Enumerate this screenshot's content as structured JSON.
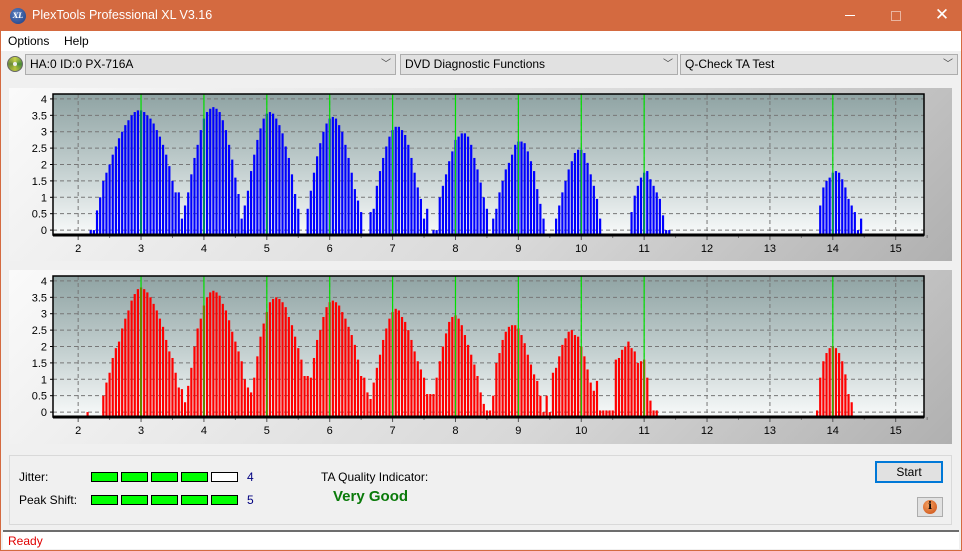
{
  "window": {
    "title": "PlexTools Professional XL V3.16",
    "app_icon_label": "XL",
    "controls": {
      "minimize": "minimize",
      "maximize": "maximize",
      "close": "✕"
    }
  },
  "menu": {
    "items": [
      "Options",
      "Help"
    ]
  },
  "toolbar": {
    "drive": "HA:0 ID:0  PX-716A",
    "function": "DVD Diagnostic Functions",
    "test": "Q-Check TA Test"
  },
  "colors": {
    "top_bars": "#0000ff",
    "bottom_bars": "#ff0000",
    "marker_lines": "#00e000",
    "titlebar": "#d46a40",
    "quality": "#0a7a0a"
  },
  "results": {
    "jitter_label": "Jitter:",
    "jitter_value": "4",
    "jitter_level": 4,
    "peak_shift_label": "Peak Shift:",
    "peak_shift_value": "5",
    "peak_shift_level": 5,
    "meter_max": 5,
    "ta_label": "TA Quality Indicator:",
    "ta_value": "Very Good"
  },
  "buttons": {
    "start": "Start",
    "info": "i"
  },
  "status": {
    "text": "Ready"
  },
  "chart_data": [
    {
      "type": "bar",
      "name": "top-ta-chart",
      "color": "#0000ff",
      "xlim": [
        1.6,
        15.45
      ],
      "ylim": [
        -0.15,
        4.15
      ],
      "xticks": [
        "2",
        "3",
        "4",
        "5",
        "6",
        "7",
        "8",
        "9",
        "10",
        "11",
        "12",
        "13",
        "14",
        "15"
      ],
      "yticks": [
        "0",
        "0.5",
        "1",
        "1.5",
        "2",
        "2.5",
        "3",
        "3.5",
        "4"
      ],
      "markers": [
        3,
        4,
        5,
        6,
        7,
        8,
        9,
        10,
        11,
        14
      ],
      "grid": true,
      "step": 0.05,
      "segments": [
        {
          "start": 2.2,
          "values": [
            0,
            0,
            0.6,
            1,
            1.5,
            1.75,
            2,
            2.3,
            2.55,
            2.8,
            3,
            3.2,
            3.35,
            3.5,
            3.6,
            3.65,
            3.65,
            3.6,
            3.5,
            3.4,
            3.25,
            3.05,
            2.85,
            2.6,
            2.3,
            1.95,
            1.5,
            1.15,
            1.15,
            0.35,
            0.75,
            1.15,
            1.7,
            2.2,
            2.6,
            3.05,
            3.4,
            3.6,
            3.7,
            3.75,
            3.7,
            3.6,
            3.35,
            3.05,
            2.6,
            2.15,
            1.6,
            1.1,
            0.35,
            0,
            0
          ]
        },
        {
          "start": 4.65,
          "values": [
            0.75,
            1.2,
            1.8,
            2.3,
            2.75,
            3.1,
            3.4,
            3.55,
            3.6,
            3.55,
            3.4,
            3.2,
            2.95,
            2.55,
            2.2,
            1.7,
            1.1,
            0.65
          ]
        },
        {
          "start": 5.65,
          "values": [
            0.65,
            1.2,
            1.75,
            2.25,
            2.65,
            3.0,
            3.25,
            3.4,
            3.45,
            3.4,
            3.2,
            3.0,
            2.6,
            2.2,
            1.75,
            1.25,
            0.9,
            0.55
          ]
        },
        {
          "start": 6.65,
          "values": [
            0.55,
            0.65,
            1.35,
            1.8,
            2.2,
            2.55,
            2.85,
            3.05,
            3.15,
            3.15,
            3.05,
            2.9,
            2.6,
            2.2,
            1.75,
            1.3,
            0.95,
            0.35,
            0.65
          ]
        },
        {
          "start": 7.65,
          "values": [
            0,
            0,
            1.0,
            1.35,
            1.7,
            2.1,
            2.4,
            2.75,
            2.85,
            2.95,
            2.95,
            2.85,
            2.6,
            2.2,
            1.85,
            1.45,
            1.0,
            0.65
          ]
        },
        {
          "start": 8.6,
          "values": [
            0.35,
            0.65,
            1.15,
            1.5,
            1.85,
            2.05,
            2.3,
            2.6,
            2.7,
            2.7,
            2.65,
            2.4,
            2.1,
            1.8,
            1.25,
            0.8,
            0.35
          ]
        },
        {
          "start": 9.6,
          "values": [
            0.35,
            0.75,
            1.15,
            1.5,
            1.85,
            2.1,
            2.35,
            2.45,
            2.45,
            2.35,
            2.05,
            1.7,
            1.35,
            0.95,
            0.35
          ]
        },
        {
          "start": 10.8,
          "values": [
            0.55,
            1.05,
            1.35,
            1.6,
            1.75,
            1.8,
            1.55,
            1.35,
            1.15,
            0.95,
            0.45,
            0,
            0
          ]
        },
        {
          "start": 13.8,
          "values": [
            0.75,
            1.3,
            1.5,
            1.6,
            1.75,
            1.8,
            1.75,
            1.55,
            1.3,
            0.95,
            0.75,
            0.55,
            0,
            0.35
          ]
        }
      ]
    },
    {
      "type": "bar",
      "name": "bottom-ta-chart",
      "color": "#ff0000",
      "xlim": [
        1.6,
        15.45
      ],
      "ylim": [
        -0.15,
        4.15
      ],
      "xticks": [
        "2",
        "3",
        "4",
        "5",
        "6",
        "7",
        "8",
        "9",
        "10",
        "11",
        "12",
        "13",
        "14",
        "15"
      ],
      "yticks": [
        "0",
        "0.5",
        "1",
        "1.5",
        "2",
        "2.5",
        "3",
        "3.5",
        "4"
      ],
      "markers": [
        3,
        4,
        5,
        6,
        7,
        8,
        9,
        10,
        11,
        14
      ],
      "grid": true,
      "step": 0.05,
      "segments": [
        {
          "start": 2.15,
          "values": [
            0
          ]
        },
        {
          "start": 2.4,
          "values": [
            0.5,
            0.9,
            1.2,
            1.65,
            1.95,
            2.15,
            2.55,
            2.85,
            3.1,
            3.4,
            3.6,
            3.75,
            3.8,
            3.75,
            3.65,
            3.5,
            3.3,
            3.1,
            2.85,
            2.6,
            2.2,
            1.85,
            1.65,
            1.2,
            0.75,
            0.7,
            0.3,
            0.8,
            1.35,
            2.0,
            2.55,
            2.85,
            3.25,
            3.5,
            3.65,
            3.7,
            3.65,
            3.55,
            3.3,
            3.1,
            2.8,
            2.45,
            2.15,
            1.85,
            1.55,
            1.0,
            0.75,
            0.6,
            1.05,
            1.7,
            2.3,
            2.7,
            3.05,
            3.35,
            3.45,
            3.5,
            3.45,
            3.35,
            3.2,
            2.9,
            2.65,
            2.3,
            1.95,
            1.6,
            1.1,
            1.1,
            1.05,
            1.65,
            2.2,
            2.5,
            2.9,
            3.2,
            3.35,
            3.4,
            3.35,
            3.25,
            3.05,
            2.85,
            2.6,
            2.35,
            2.05,
            1.6,
            1.1,
            1.05,
            0.6,
            0.4,
            0.9,
            1.35,
            1.75,
            2.2,
            2.55,
            2.85,
            3.05,
            3.15,
            3.1,
            2.9,
            2.75,
            2.5,
            2.2,
            1.85,
            1.55,
            1.3,
            1.05,
            0.55,
            0.55,
            0.55,
            1.05,
            1.55,
            2.0,
            2.4,
            2.75,
            2.9,
            2.95,
            2.85,
            2.65,
            2.35,
            2.05,
            1.75,
            1.45,
            1.1,
            0.6,
            0.25,
            0.05,
            0.05,
            0.5,
            1.5,
            1.8,
            2.2,
            2.45,
            2.6,
            2.65,
            2.65,
            2.55,
            2.35,
            2.1,
            1.75,
            1.45,
            1.15,
            0.95,
            0.5,
            0,
            0.5,
            0,
            1.2,
            1.35,
            1.7,
            2.05,
            2.25,
            2.45,
            2.5,
            2.35,
            2.3,
            2.0,
            1.7,
            1.3,
            0.9,
            0.65,
            0.95,
            0.05,
            0.05,
            0.05,
            0.05,
            0.05,
            1.6,
            1.65,
            1.9,
            2.0,
            2.15,
            1.95,
            1.85,
            1.5,
            1.55,
            1.6,
            1.05,
            0.35,
            0.05,
            0.05
          ]
        },
        {
          "start": 13.75,
          "values": [
            0.05,
            1.05,
            1.55,
            1.8,
            1.95,
            2.0,
            1.95,
            1.8,
            1.55,
            1.15,
            0.55,
            0.3
          ]
        }
      ]
    }
  ]
}
